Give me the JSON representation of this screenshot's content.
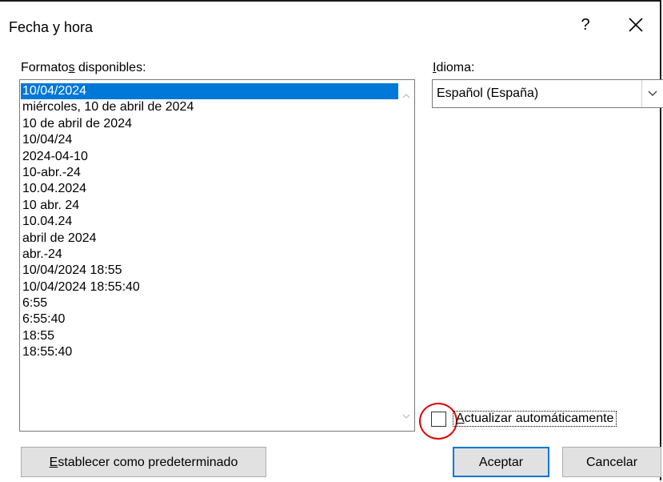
{
  "window": {
    "title": "Fecha y hora",
    "help_label": "?",
    "close_icon": "close-icon"
  },
  "formats": {
    "label_before": "Formato",
    "label_underlined": "s",
    "label_after": " disponibles:",
    "items": [
      "10/04/2024",
      "miércoles, 10 de abril de 2024",
      "10 de abril de 2024",
      "10/04/24",
      "2024-04-10",
      "10-abr.-24",
      "10.04.2024",
      "10 abr. 24",
      "10.04.24",
      "abril de 2024",
      "abr.-24",
      "10/04/2024 18:55",
      "10/04/2024 18:55:40",
      "6:55",
      "6:55:40",
      "18:55",
      "18:55:40"
    ],
    "selected_index": 0
  },
  "language": {
    "label_underlined": "I",
    "label_after": "dioma:",
    "selected_value": "Español (España)"
  },
  "auto_update": {
    "label_underlined": "A",
    "label_after": "ctualizar automáticamente",
    "checked": false
  },
  "buttons": {
    "set_default_underlined": "E",
    "set_default_after": "stablecer como predeterminado",
    "ok": "Aceptar",
    "cancel": "Cancelar"
  },
  "colors": {
    "selection": "#0078d7",
    "highlight_circle": "#e00000"
  }
}
